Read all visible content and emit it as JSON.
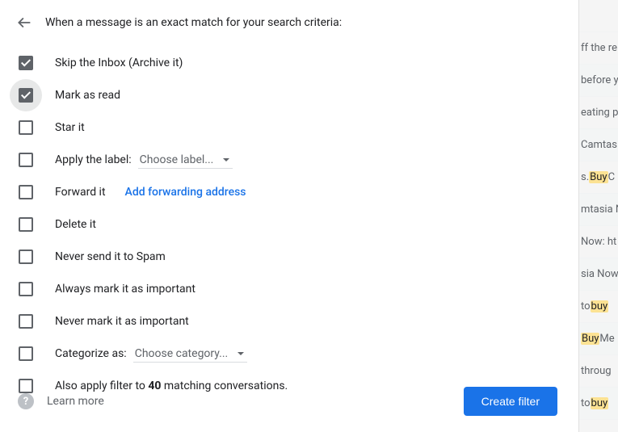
{
  "header": {
    "title": "When a message is an exact match for your search criteria:"
  },
  "options": {
    "skip_inbox": {
      "label": "Skip the Inbox (Archive it)",
      "checked": true
    },
    "mark_read": {
      "label": "Mark as read",
      "checked": true,
      "hover": true
    },
    "star": {
      "label": "Star it",
      "checked": false
    },
    "apply_label": {
      "label": "Apply the label:",
      "checked": false,
      "dropdown": "Choose label..."
    },
    "forward": {
      "label": "Forward it",
      "checked": false,
      "link": "Add forwarding address"
    },
    "delete": {
      "label": "Delete it",
      "checked": false
    },
    "never_spam": {
      "label": "Never send it to Spam",
      "checked": false
    },
    "always_important": {
      "label": "Always mark it as important",
      "checked": false
    },
    "never_important": {
      "label": "Never mark it as important",
      "checked": false
    },
    "categorize": {
      "label": "Categorize as:",
      "checked": false,
      "dropdown": "Choose category..."
    },
    "also_apply": {
      "prefix": "Also apply filter to ",
      "count": "40",
      "suffix": " matching conversations.",
      "checked": false
    }
  },
  "footer": {
    "learn_more": "Learn more",
    "create": "Create filter"
  },
  "bg": {
    "items": [
      {
        "t1": "",
        "hl": "",
        "t2": ""
      },
      {
        "t1": "ff the re",
        "hl": "",
        "t2": ""
      },
      {
        "t1": "before y",
        "hl": "",
        "t2": ""
      },
      {
        "t1": "eating p",
        "hl": "",
        "t2": ""
      },
      {
        "t1": "Camtas",
        "hl": "",
        "t2": ""
      },
      {
        "t1": "s. ",
        "hl": "Buy",
        "t2": " C"
      },
      {
        "t1": "mtasia N",
        "hl": "",
        "t2": ""
      },
      {
        "t1": "Now: ht",
        "hl": "",
        "t2": ""
      },
      {
        "t1": "sia Now",
        "hl": "",
        "t2": ""
      },
      {
        "t1": " to ",
        "hl": "buy",
        "t2": " "
      },
      {
        "t1": "",
        "hl": "Buy",
        "t2": " Me"
      },
      {
        "t1": " throug",
        "hl": "",
        "t2": ""
      },
      {
        "t1": " to ",
        "hl": "buy",
        "t2": ""
      }
    ]
  }
}
